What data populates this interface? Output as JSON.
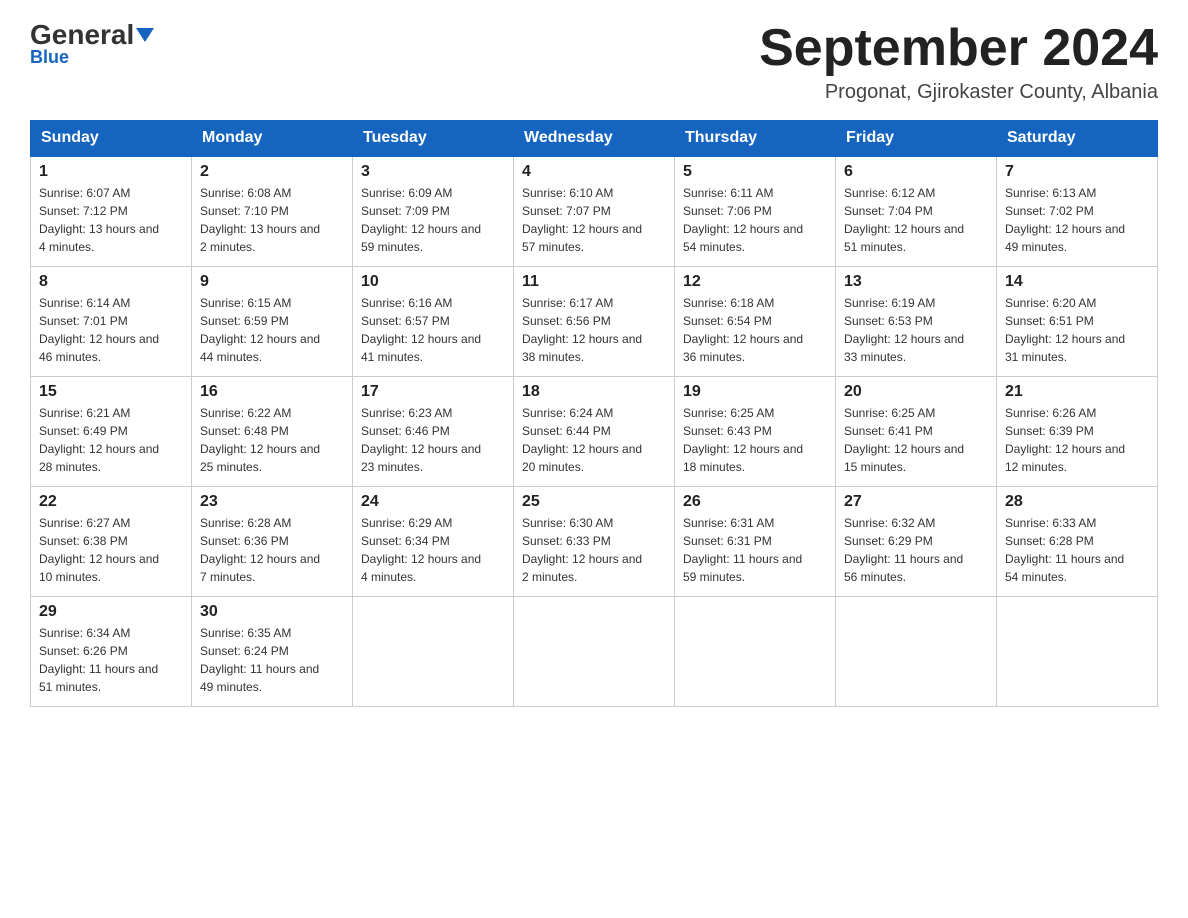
{
  "logo": {
    "general": "General",
    "triangle": "▲",
    "blue": "Blue"
  },
  "header": {
    "title": "September 2024",
    "location": "Progonat, Gjirokaster County, Albania"
  },
  "days_of_week": [
    "Sunday",
    "Monday",
    "Tuesday",
    "Wednesday",
    "Thursday",
    "Friday",
    "Saturday"
  ],
  "weeks": [
    [
      {
        "day": "1",
        "sunrise": "6:07 AM",
        "sunset": "7:12 PM",
        "daylight": "13 hours and 4 minutes."
      },
      {
        "day": "2",
        "sunrise": "6:08 AM",
        "sunset": "7:10 PM",
        "daylight": "13 hours and 2 minutes."
      },
      {
        "day": "3",
        "sunrise": "6:09 AM",
        "sunset": "7:09 PM",
        "daylight": "12 hours and 59 minutes."
      },
      {
        "day": "4",
        "sunrise": "6:10 AM",
        "sunset": "7:07 PM",
        "daylight": "12 hours and 57 minutes."
      },
      {
        "day": "5",
        "sunrise": "6:11 AM",
        "sunset": "7:06 PM",
        "daylight": "12 hours and 54 minutes."
      },
      {
        "day": "6",
        "sunrise": "6:12 AM",
        "sunset": "7:04 PM",
        "daylight": "12 hours and 51 minutes."
      },
      {
        "day": "7",
        "sunrise": "6:13 AM",
        "sunset": "7:02 PM",
        "daylight": "12 hours and 49 minutes."
      }
    ],
    [
      {
        "day": "8",
        "sunrise": "6:14 AM",
        "sunset": "7:01 PM",
        "daylight": "12 hours and 46 minutes."
      },
      {
        "day": "9",
        "sunrise": "6:15 AM",
        "sunset": "6:59 PM",
        "daylight": "12 hours and 44 minutes."
      },
      {
        "day": "10",
        "sunrise": "6:16 AM",
        "sunset": "6:57 PM",
        "daylight": "12 hours and 41 minutes."
      },
      {
        "day": "11",
        "sunrise": "6:17 AM",
        "sunset": "6:56 PM",
        "daylight": "12 hours and 38 minutes."
      },
      {
        "day": "12",
        "sunrise": "6:18 AM",
        "sunset": "6:54 PM",
        "daylight": "12 hours and 36 minutes."
      },
      {
        "day": "13",
        "sunrise": "6:19 AM",
        "sunset": "6:53 PM",
        "daylight": "12 hours and 33 minutes."
      },
      {
        "day": "14",
        "sunrise": "6:20 AM",
        "sunset": "6:51 PM",
        "daylight": "12 hours and 31 minutes."
      }
    ],
    [
      {
        "day": "15",
        "sunrise": "6:21 AM",
        "sunset": "6:49 PM",
        "daylight": "12 hours and 28 minutes."
      },
      {
        "day": "16",
        "sunrise": "6:22 AM",
        "sunset": "6:48 PM",
        "daylight": "12 hours and 25 minutes."
      },
      {
        "day": "17",
        "sunrise": "6:23 AM",
        "sunset": "6:46 PM",
        "daylight": "12 hours and 23 minutes."
      },
      {
        "day": "18",
        "sunrise": "6:24 AM",
        "sunset": "6:44 PM",
        "daylight": "12 hours and 20 minutes."
      },
      {
        "day": "19",
        "sunrise": "6:25 AM",
        "sunset": "6:43 PM",
        "daylight": "12 hours and 18 minutes."
      },
      {
        "day": "20",
        "sunrise": "6:25 AM",
        "sunset": "6:41 PM",
        "daylight": "12 hours and 15 minutes."
      },
      {
        "day": "21",
        "sunrise": "6:26 AM",
        "sunset": "6:39 PM",
        "daylight": "12 hours and 12 minutes."
      }
    ],
    [
      {
        "day": "22",
        "sunrise": "6:27 AM",
        "sunset": "6:38 PM",
        "daylight": "12 hours and 10 minutes."
      },
      {
        "day": "23",
        "sunrise": "6:28 AM",
        "sunset": "6:36 PM",
        "daylight": "12 hours and 7 minutes."
      },
      {
        "day": "24",
        "sunrise": "6:29 AM",
        "sunset": "6:34 PM",
        "daylight": "12 hours and 4 minutes."
      },
      {
        "day": "25",
        "sunrise": "6:30 AM",
        "sunset": "6:33 PM",
        "daylight": "12 hours and 2 minutes."
      },
      {
        "day": "26",
        "sunrise": "6:31 AM",
        "sunset": "6:31 PM",
        "daylight": "11 hours and 59 minutes."
      },
      {
        "day": "27",
        "sunrise": "6:32 AM",
        "sunset": "6:29 PM",
        "daylight": "11 hours and 56 minutes."
      },
      {
        "day": "28",
        "sunrise": "6:33 AM",
        "sunset": "6:28 PM",
        "daylight": "11 hours and 54 minutes."
      }
    ],
    [
      {
        "day": "29",
        "sunrise": "6:34 AM",
        "sunset": "6:26 PM",
        "daylight": "11 hours and 51 minutes."
      },
      {
        "day": "30",
        "sunrise": "6:35 AM",
        "sunset": "6:24 PM",
        "daylight": "11 hours and 49 minutes."
      },
      null,
      null,
      null,
      null,
      null
    ]
  ],
  "labels": {
    "sunrise": "Sunrise: ",
    "sunset": "Sunset: ",
    "daylight": "Daylight: "
  }
}
